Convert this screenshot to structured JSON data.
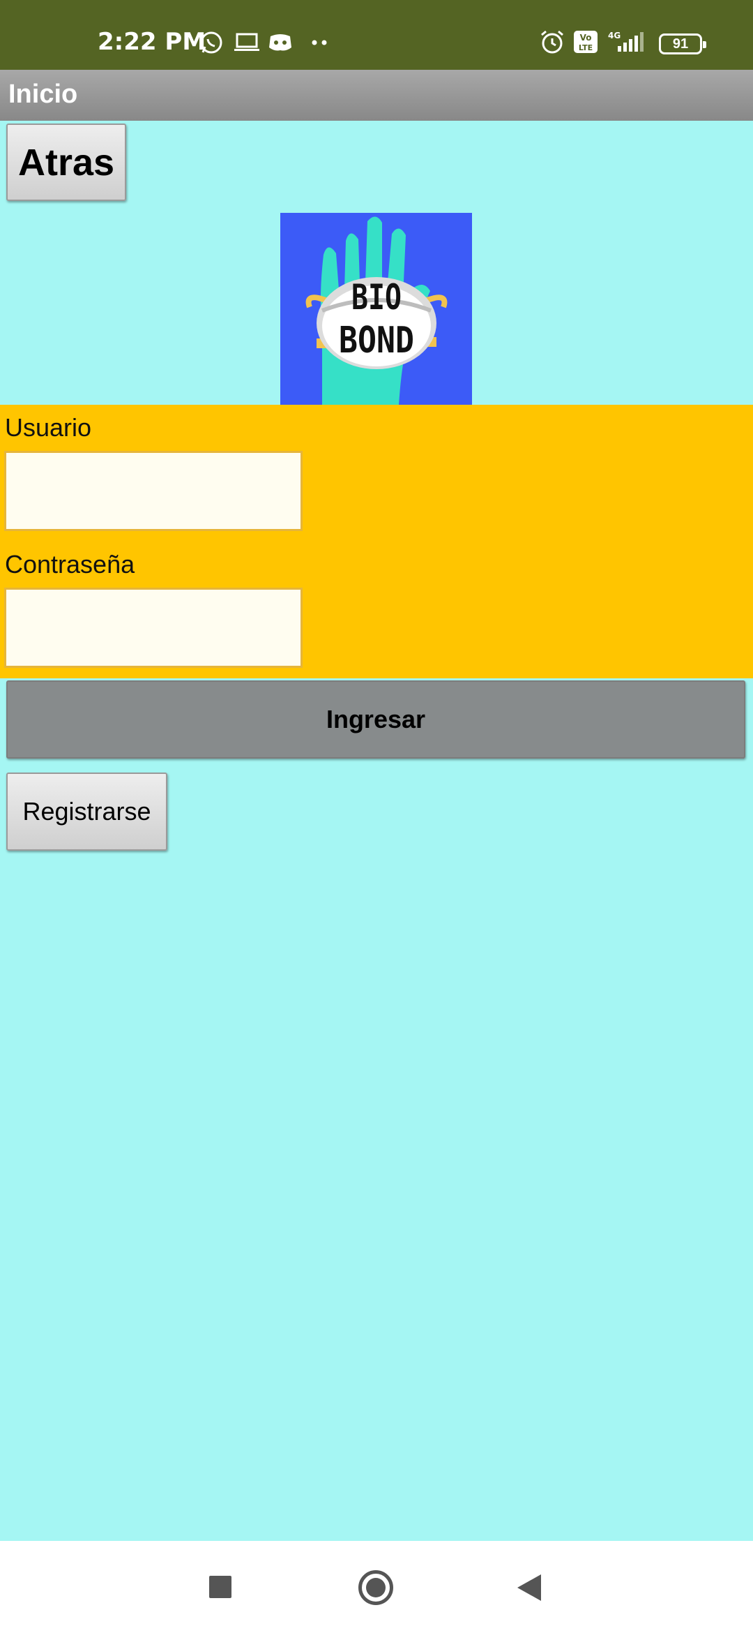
{
  "status_bar": {
    "time": "2:22 PM",
    "battery": "91",
    "network": "4G",
    "icons": [
      "whatsapp-icon",
      "laptop-icon",
      "discord-icon",
      "more-dots-icon",
      "alarm-icon",
      "volte-icon",
      "signal-icon",
      "battery-icon"
    ]
  },
  "app_bar": {
    "title": "Inicio"
  },
  "buttons": {
    "back": "Atras",
    "login": "Ingresar",
    "register": "Registrarse"
  },
  "logo": {
    "line1": "BIO",
    "line2": "BOND"
  },
  "form": {
    "user_label": "Usuario",
    "user_value": "",
    "password_label": "Contraseña",
    "password_value": ""
  },
  "colors": {
    "status_bar": "#546423",
    "background": "#a5f6f3",
    "form_panel": "#ffc500",
    "logo_bg": "#3c5bf7",
    "login_button": "#878b8c"
  }
}
